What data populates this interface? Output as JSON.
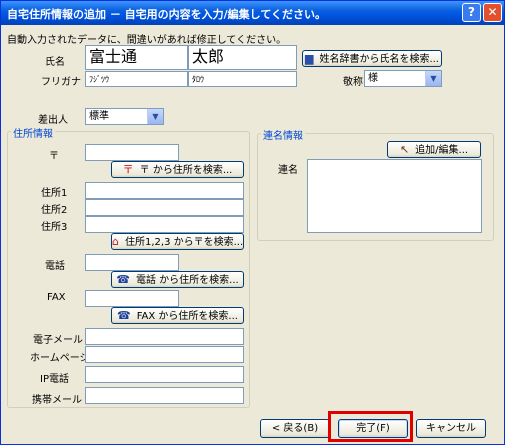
{
  "title": "自宅住所情報の追加 － 自宅用の内容を入力/編集してください。",
  "title_buttons": {
    "help": "?",
    "close": "✕"
  },
  "instruction": "自動入力されたデータに、間違いがあれば修正してください。",
  "name": {
    "label": "氏名",
    "last": "富士通",
    "first": "太郎",
    "lookup_button": "姓名辞書から氏名を検索..."
  },
  "furigana": {
    "label": "フリガナ",
    "last": "ﾌｼﾞﾂｳ",
    "first": "ﾀﾛｳ"
  },
  "honorific": {
    "label": "敬称",
    "value": "様"
  },
  "sender": {
    "label": "差出人",
    "value": "標準"
  },
  "address_group": {
    "title": "住所情報",
    "postal_label": "〒",
    "postal_value": "",
    "postal_search_button": "〒 から住所を検索...",
    "addr1_label": "住所1",
    "addr2_label": "住所2",
    "addr3_label": "住所3",
    "addr_search_button": "住所1,2,3 から〒を検索...",
    "phone_label": "電話",
    "phone_search_button": "電話 から住所を検索...",
    "fax_label": "FAX",
    "fax_search_button": "FAX から住所を検索...",
    "email_label": "電子メール",
    "homepage_label": "ホームページ",
    "ipphone_label": "IP電話",
    "mobile_label": "携帯メール"
  },
  "joint_group": {
    "title": "連名情報",
    "add_edit_button": "追加/編集...",
    "joint_label": "連名"
  },
  "footer": {
    "back_button": "< 戻る(B)",
    "finish_button": "完了(F)",
    "cancel_button": "キャンセル"
  },
  "colors": {
    "highlight": "#e00000",
    "title_bar": "#0054e3",
    "group_title": "#0046d5"
  }
}
